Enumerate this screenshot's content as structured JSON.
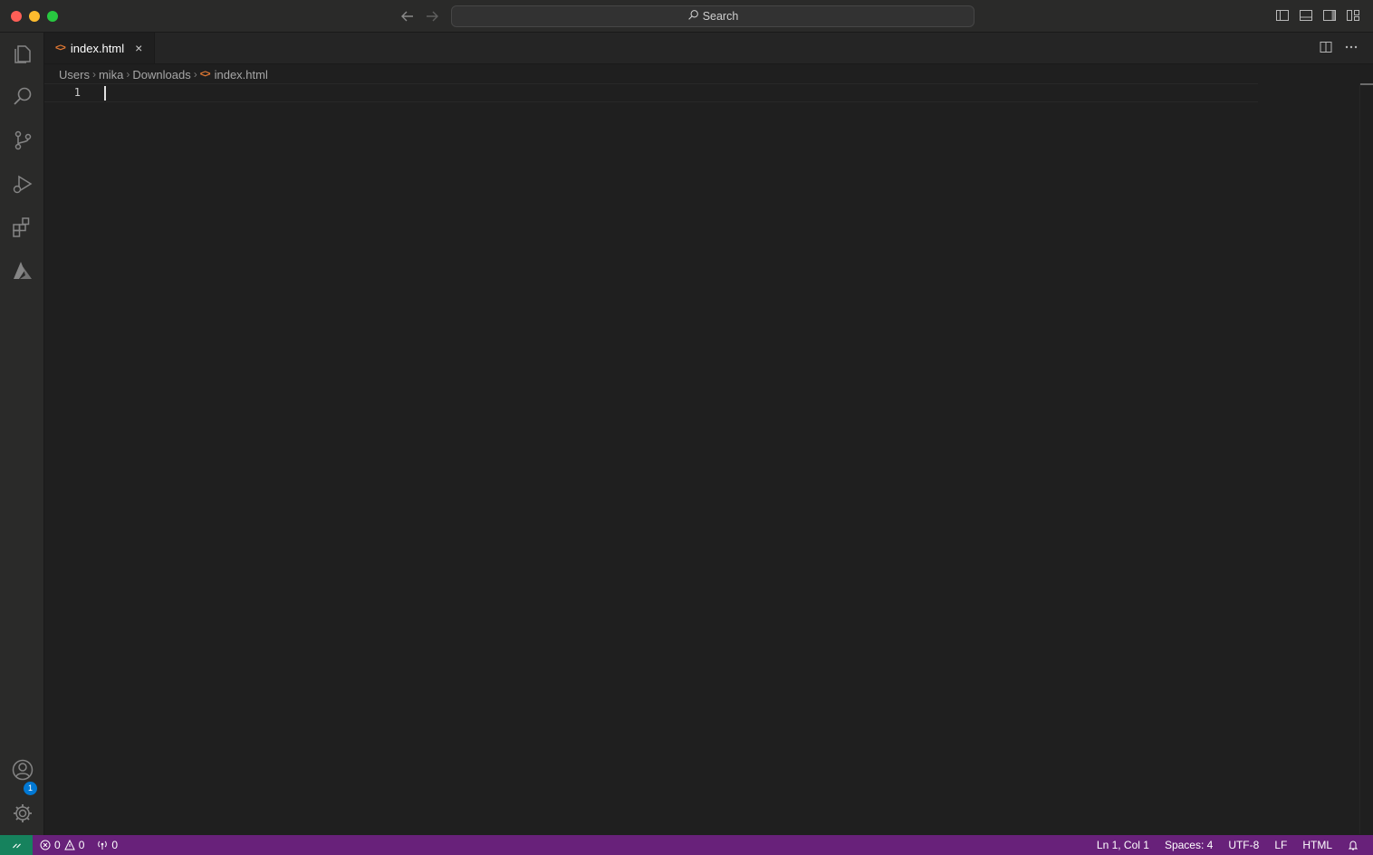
{
  "titlebar": {
    "search_label": "Search"
  },
  "tab": {
    "icon": "<>",
    "label": "index.html",
    "close": "×"
  },
  "breadcrumb": {
    "parts": [
      "Users",
      "mika",
      "Downloads"
    ],
    "file_icon": "<>",
    "file": "index.html"
  },
  "editor": {
    "line_number": "1"
  },
  "activity": {
    "settings_badge": "1"
  },
  "statusbar": {
    "errors": "0",
    "warnings": "0",
    "ports": "0",
    "position": "Ln 1, Col 1",
    "spaces": "Spaces: 4",
    "encoding": "UTF-8",
    "eol": "LF",
    "language": "HTML"
  },
  "colors": {
    "statusbar": "#68217a",
    "remote": "#16825d",
    "accent_badge": "#0078d4",
    "html_icon": "#e37933"
  }
}
